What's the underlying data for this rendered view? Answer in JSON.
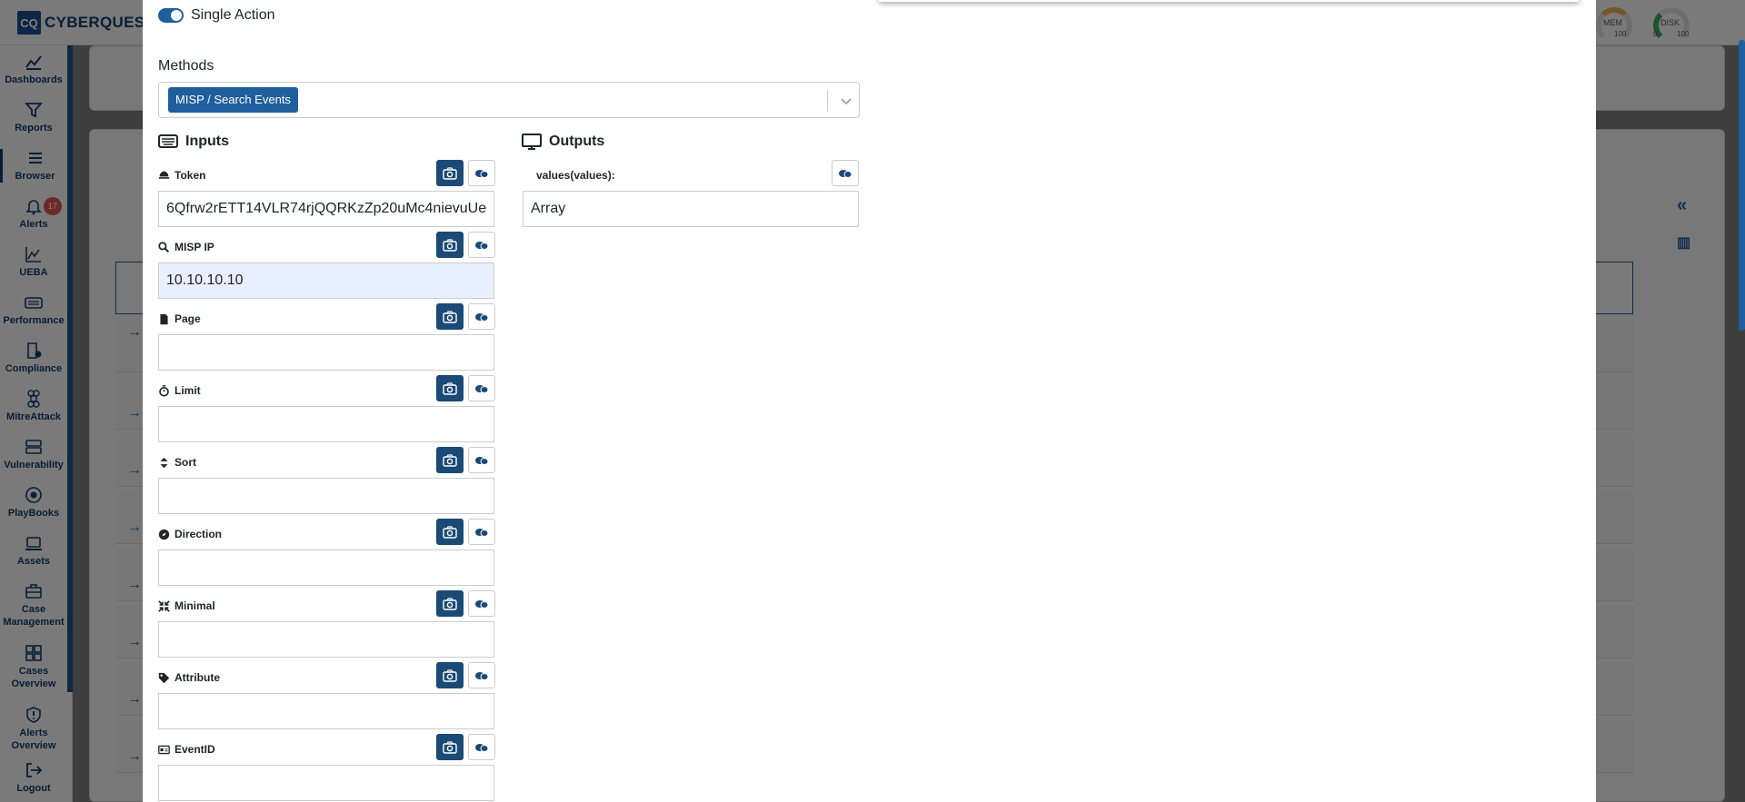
{
  "app": {
    "logo_mark": "CQ",
    "logo_text": "CYBERQUES"
  },
  "gauges": [
    {
      "label": "MEM",
      "min": "",
      "max": "100"
    },
    {
      "label": "DISK",
      "min": "0",
      "max": "100"
    }
  ],
  "sidebar": {
    "items": [
      {
        "label": "Dashboards",
        "icon": "dashboard-icon"
      },
      {
        "label": "Reports",
        "icon": "filter-icon"
      },
      {
        "label": "Browser",
        "icon": "browser-icon"
      },
      {
        "label": "Alerts",
        "icon": "bell-icon",
        "badge": "17"
      },
      {
        "label": "UEBA",
        "icon": "chart-icon"
      },
      {
        "label": "Performance",
        "icon": "keyboard-icon"
      },
      {
        "label": "Compliance",
        "icon": "compliance-icon"
      },
      {
        "label": "MitreAttack",
        "icon": "command-icon"
      },
      {
        "label": "Vulnerability",
        "icon": "server-icon"
      },
      {
        "label": "PlayBooks",
        "icon": "playbook-icon"
      },
      {
        "label": "Assets",
        "icon": "laptop-icon"
      },
      {
        "label": "Case Management",
        "icon": "briefcase-icon"
      },
      {
        "label": "Cases Overview",
        "icon": "grid-icon"
      },
      {
        "label": "Alerts Overview",
        "icon": "alert-shield-icon"
      },
      {
        "label": "Logout",
        "icon": "logout-icon"
      }
    ]
  },
  "modal": {
    "single_action_label": "Single Action",
    "methods_label": "Methods",
    "method_selected": "MISP / Search Events",
    "inputs_title": "Inputs",
    "outputs_title": "Outputs",
    "inputs": [
      {
        "label": "Token",
        "icon": "hat-icon",
        "value": "6Qfrw2rETT14VLR74rjQQRKzZp20uMc4nievuUe"
      },
      {
        "label": "MISP IP",
        "icon": "search-icon",
        "value": "10.10.10.10"
      },
      {
        "label": "Page",
        "icon": "file-icon",
        "value": ""
      },
      {
        "label": "Limit",
        "icon": "stopwatch-icon",
        "value": ""
      },
      {
        "label": "Sort",
        "icon": "sort-icon",
        "value": ""
      },
      {
        "label": "Direction",
        "icon": "compass-icon",
        "value": ""
      },
      {
        "label": "Minimal",
        "icon": "compress-icon",
        "value": ""
      },
      {
        "label": "Attribute",
        "icon": "tag-icon",
        "value": ""
      },
      {
        "label": "EventID",
        "icon": "id-card-icon",
        "value": ""
      }
    ],
    "outputs": [
      {
        "label": "values(values):",
        "value": "Array"
      }
    ]
  },
  "colors": {
    "primary": "#1f5f9e",
    "dark_button": "#1a4a75",
    "badge": "#d9534f"
  }
}
